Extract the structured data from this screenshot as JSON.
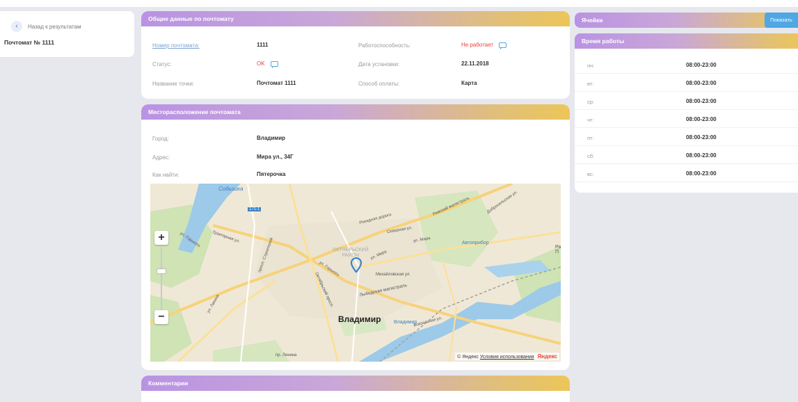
{
  "sidebar": {
    "back_label": "Назад к результатам",
    "back_icon": "chevron-left-icon",
    "title": "Почтомат № 1111"
  },
  "general": {
    "header": "Общие данные по почтомату",
    "number_label": "Номер почтомата:",
    "number_value": "1111",
    "health_label": "Работоспособность:",
    "health_value": "Не работает",
    "status_label": "Статус:",
    "status_value": "OK",
    "install_label": "Дата установки:",
    "install_value": "22.11.2018",
    "point_label": "Название точки:",
    "point_value": "Почтомат 1111",
    "payment_label": "Способ оплаты:",
    "payment_value": "Карта"
  },
  "location": {
    "header": "Месторасположение почтомата",
    "city_label": "Город:",
    "city_value": "Владимир",
    "address_label": "Адрес:",
    "address_value": "Мира ул., 34Г",
    "find_label": "Как найти:",
    "find_value": "Пятерочка"
  },
  "map": {
    "zoom_in": "+",
    "zoom_out": "−",
    "city": "Владимир",
    "district": "ОКТЯБРЬСКИЙ\nРАЙОН",
    "labels": {
      "sodyshka": "Содышка",
      "road": "171-1",
      "rokadnaya": "Рокадная дорога",
      "severnaya": "Северная ул.",
      "mira": "ул. Мира",
      "gorkogo": "ул. Горького",
      "gorkogo2": "ул. Горького",
      "mikhailovskaya": "Михайловская ул.",
      "lybedskaya": "Лыбедская магистраль",
      "avtopribor": "Автоприбор",
      "station": "Владимир",
      "traktornaya": "Тракторная ул.",
      "lakina": "ул. Лакина",
      "lenina": "пр. Ленина",
      "stroiteley": "просп. Строителей",
      "oktyabrskiy": "Октябрьский просп.",
      "mira2": "ул. Мира",
      "rizhskaya": "Рижский магистраль",
      "dobroselskaya": "Добросельская ул.",
      "vokzalnaya": "Вокзальная ул.",
      "gastello": "ул. Гастелло",
      "chaikovskogo": "ул. Чайковского",
      "edge_label": "Ра П"
    },
    "copyright": "© Яндекс",
    "terms": "Условия использования",
    "logo": "Яндекс"
  },
  "comments": {
    "header": "Комментарии"
  },
  "cells": {
    "header": "Ячейки",
    "show_button": "Показать"
  },
  "hours": {
    "header": "Время работы",
    "rows": [
      {
        "day": "пн:",
        "time": "08:00-23:00"
      },
      {
        "day": "вт:",
        "time": "08:00-23:00"
      },
      {
        "day": "ср:",
        "time": "08:00-23:00"
      },
      {
        "day": "чт:",
        "time": "08:00-23:00"
      },
      {
        "day": "пт:",
        "time": "08:00-23:00"
      },
      {
        "day": "сб:",
        "time": "08:00-23:00"
      },
      {
        "day": "вс:",
        "time": "08:00-23:00"
      }
    ]
  },
  "colors": {
    "accent_purple": "#b993e3",
    "accent_gold": "#ecc659",
    "error": "#e8413b",
    "link": "#7ba3d6",
    "button": "#4fa7e3"
  }
}
